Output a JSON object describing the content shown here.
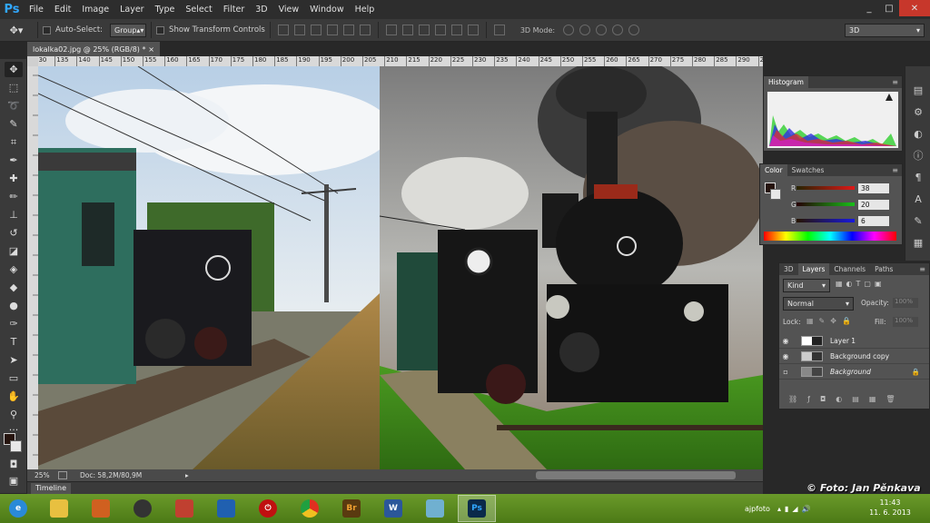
{
  "app": {
    "logo": "Ps"
  },
  "menu": [
    "File",
    "Edit",
    "Image",
    "Layer",
    "Type",
    "Select",
    "Filter",
    "3D",
    "View",
    "Window",
    "Help"
  ],
  "window_controls": [
    "_",
    "□",
    "✕"
  ],
  "options": {
    "auto_select_label": "Auto-Select:",
    "auto_select_value": "Group",
    "transform_label": "Show Transform Controls",
    "mode3d_label": "3D Mode:",
    "workspace": "3D"
  },
  "document": {
    "tab_title": "lokalka02.jpg @ 25% (RGB/8) *",
    "tab_close": "×"
  },
  "ruler_ticks": [
    "130",
    "135",
    "140",
    "145",
    "150",
    "155",
    "160",
    "165",
    "170",
    "175",
    "180",
    "185",
    "190",
    "195",
    "200",
    "205",
    "210",
    "215",
    "220",
    "225",
    "230",
    "235",
    "240",
    "245",
    "250",
    "255",
    "260",
    "265",
    "270",
    "275",
    "280",
    "285",
    "290",
    "295",
    "300"
  ],
  "status": {
    "zoom": "25%",
    "doc_size": "Doc: 58,2M/80,9M"
  },
  "timeline": {
    "label": "Timeline"
  },
  "histogram": {
    "title": "Histogram"
  },
  "color_panel": {
    "tabs": [
      "Color",
      "Swatches"
    ],
    "channels": [
      {
        "label": "R",
        "value": "38",
        "color": "#e01818"
      },
      {
        "label": "G",
        "value": "20",
        "color": "#18c018"
      },
      {
        "label": "B",
        "value": "6",
        "color": "#1818e0"
      }
    ]
  },
  "layers_panel": {
    "tabs": [
      "3D",
      "Layers",
      "Channels",
      "Paths"
    ],
    "kind": "Kind",
    "blend_mode": "Normal",
    "opacity_label": "Opacity:",
    "opacity_value": "100%",
    "lock_label": "Lock:",
    "fill_label": "Fill:",
    "fill_value": "100%",
    "layers": [
      {
        "name": "Layer 1",
        "visible": true
      },
      {
        "name": "Background copy",
        "visible": true
      },
      {
        "name": "Background",
        "visible": false,
        "locked": true
      }
    ]
  },
  "watermark": "© Foto: Jan Pěnkava",
  "tray": {
    "user": "ajpfoto",
    "time": "11:43",
    "date": "11. 6. 2013"
  },
  "taskbar_apps": [
    {
      "icon": "ie-icon",
      "glyph": "e",
      "color": "#2a8ad8"
    },
    {
      "icon": "explorer-icon",
      "glyph": "",
      "color": "#e8c040"
    },
    {
      "icon": "app-orange-icon",
      "glyph": "",
      "color": "#d06020"
    },
    {
      "icon": "speaker-icon",
      "glyph": "",
      "color": "#333333"
    },
    {
      "icon": "app-box-icon",
      "glyph": "",
      "color": "#c04030"
    },
    {
      "icon": "app-blue-icon",
      "glyph": "",
      "color": "#2060b0"
    },
    {
      "icon": "power-icon",
      "glyph": "⏻",
      "color": "#c01010"
    },
    {
      "icon": "chrome-icon",
      "glyph": "",
      "color": "#e0a020"
    },
    {
      "icon": "bridge-icon",
      "glyph": "Br",
      "color": "#5a3a10"
    },
    {
      "icon": "word-icon",
      "glyph": "W",
      "color": "#2b579a"
    },
    {
      "icon": "app-glass-icon",
      "glyph": "",
      "color": "#70b0d0"
    },
    {
      "icon": "photoshop-icon",
      "glyph": "Ps",
      "color": "#0b2a4a"
    }
  ]
}
